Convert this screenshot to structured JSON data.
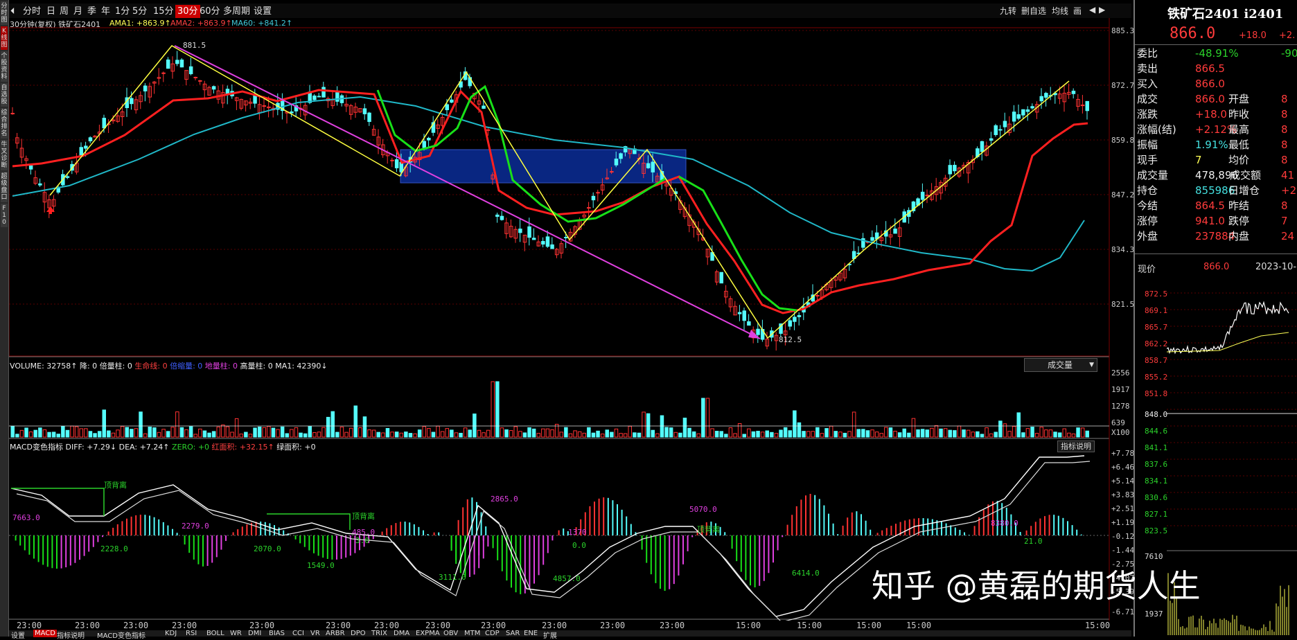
{
  "sidebar": {
    "tabs": [
      "分时图",
      "K线图",
      "个股资料",
      "自选股",
      "综合排名",
      "牛叉诊断",
      "超级盘口",
      "F10"
    ]
  },
  "toolbar": {
    "timeframes": [
      "分时",
      "日",
      "周",
      "月",
      "季",
      "年",
      "1分",
      "5分",
      "15分",
      "30分",
      "60分",
      "多周期",
      "设置"
    ],
    "active": "30分",
    "right_buttons": [
      "九转",
      "删自选",
      "均线",
      "画"
    ]
  },
  "chart_header": {
    "symbol_label": "30分钟(复权)  铁矿石2401",
    "ama1": "AMA1: +863.9↑",
    "ama2": "AMA2: +863.9↑",
    "ma60": "MA60: +841.2↑"
  },
  "price_axis": [
    "885.3",
    "872.7",
    "859.8",
    "847.2",
    "834.3",
    "821.5"
  ],
  "price_annotations": {
    "high": "881.5",
    "low": "812.5"
  },
  "volume_header": {
    "volume": "VOLUME: 32758↑",
    "jiang": "降: 0",
    "beiliang": "倍量柱: 0",
    "shengming": "生命线: 0",
    "beisuoliang": "倍缩量: 0",
    "diliang": "地量柱: 0",
    "gaoliang": "高量柱: 0",
    "ma1": "MA1: 42390↓"
  },
  "volume_selector": "成交量",
  "volume_axis": [
    "2556",
    "1917",
    "1278",
    "639",
    "X100"
  ],
  "volume_markers": {
    "high": "高",
    "double": "倍"
  },
  "macd_header": {
    "name": "MACD变色指标",
    "diff": "DIFF: +7.29↓",
    "dea": "DEA: +7.24↑",
    "zero": "ZERO: +0",
    "red_area": "红面积: +32.15↑",
    "green_area": "绿面积: +0"
  },
  "macd_button": "指标说明",
  "macd_axis": [
    "+7.78",
    "+6.46",
    "+5.14",
    "+3.83",
    "+2.51",
    "+1.19",
    "-0.123",
    "-1.44",
    "-2.75",
    "-4.07",
    "-5.39",
    "-6.71"
  ],
  "macd_annotations": [
    "7663.0",
    "2228.0",
    "2279.0",
    "2070.0",
    "1549.0",
    "485.0",
    "3.0",
    "3111.0",
    "2865.0",
    "4857.0",
    "1370",
    "0.0",
    "5070.0",
    "6414.0",
    "8380.0",
    "21.0"
  ],
  "divergence_label": "顶背离",
  "x_axis": [
    "23:00",
    "23:00",
    "23:00",
    "23:00",
    "23:00",
    "23:00",
    "23:00",
    "23:00",
    "23:00",
    "23:00",
    "23:00",
    "23:00",
    "15:00",
    "15:00",
    "15:00",
    "15:00",
    "15:00"
  ],
  "bottom_tabs": [
    "设置",
    "MACD",
    "指标说明",
    "MACD变色指标",
    "KDJ",
    "RSI",
    "BOLL",
    "WR",
    "DMI",
    "BIAS",
    "CCI",
    "VR",
    "ARBR",
    "DPO",
    "TRIX",
    "DMA",
    "EXPMA",
    "OBV",
    "MTM",
    "CDP",
    "SAR",
    "ENE",
    "扩展"
  ],
  "quote": {
    "name": "铁矿石2401 i2401",
    "price": "866.0",
    "change": "+18.0",
    "change_pct": "+2.",
    "rows": [
      {
        "label": "委比",
        "value": "-48.91%",
        "value2": "-90",
        "vclass": "grn"
      },
      {
        "label": "卖出",
        "value": "866.5",
        "value2": "",
        "vclass": "red"
      },
      {
        "label": "买入",
        "value": "866.0",
        "value2": "",
        "vclass": "red"
      },
      {
        "label": "成交",
        "value": "866.0",
        "label2": "开盘",
        "value2": "8",
        "vclass": "red"
      },
      {
        "label": "涨跌",
        "value": "+18.0",
        "label2": "昨收",
        "value2": "8",
        "vclass": "red"
      },
      {
        "label": "涨幅(结)",
        "value": "+2.12%",
        "label2": "最高",
        "value2": "8",
        "vclass": "red"
      },
      {
        "label": "振幅",
        "value": "1.91%",
        "label2": "最低",
        "value2": "8",
        "vclass": "cy"
      },
      {
        "label": "现手",
        "value": "7",
        "label2": "均价",
        "value2": "8",
        "vclass": "yel"
      },
      {
        "label": "成交量",
        "value": "478,896",
        "label2": "成交额",
        "value2": "41",
        "vclass": "wht"
      },
      {
        "label": "持仓",
        "value": "855986",
        "label2": "日增仓",
        "value2": "+2",
        "vclass": "cy"
      },
      {
        "label": "今结",
        "value": "864.5",
        "label2": "昨结",
        "value2": "8",
        "vclass": "red"
      },
      {
        "label": "涨停",
        "value": "941.0",
        "label2": "跌停",
        "value2": "7",
        "vclass": "red"
      },
      {
        "label": "外盘",
        "value": "237884",
        "label2": "内盘",
        "value2": "24",
        "vclass": "red"
      }
    ],
    "mini_title": "现价",
    "mini_price": "866.0",
    "mini_date": "2023-10-",
    "mini_axis": [
      "872.5",
      "869.1",
      "865.7",
      "862.2",
      "858.7",
      "855.2",
      "851.8",
      "848.0",
      "844.6",
      "841.1",
      "837.6",
      "834.1",
      "830.6",
      "827.1",
      "823.5",
      "7610",
      "1937"
    ]
  },
  "watermark": "知乎 @黄磊的期货人生",
  "colors": {
    "up": "#ff3232",
    "down": "#54fcfc",
    "ama": "#ff2020",
    "ma60": "#20b8c8",
    "green_line": "#18e018",
    "zigzag": "#ffff40",
    "trend": "#e040e0",
    "box": "#0a2a8c"
  }
}
